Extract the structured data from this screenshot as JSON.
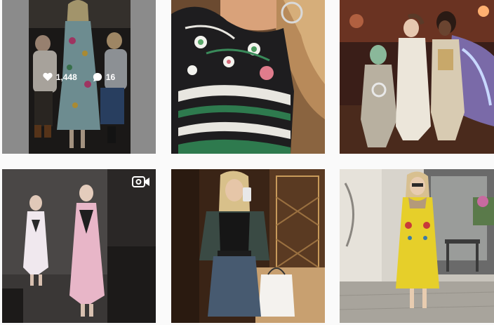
{
  "grid": {
    "posts": [
      {
        "stats": {
          "likes": "1,448",
          "comments": "16"
        },
        "hovered": true,
        "is_video": false,
        "icon": "heart-icon"
      },
      {
        "hovered": false,
        "is_video": false
      },
      {
        "hovered": false,
        "is_video": false
      },
      {
        "hovered": false,
        "is_video": true,
        "icon": "video-camera-icon"
      },
      {
        "hovered": false,
        "is_video": false
      },
      {
        "hovered": false,
        "is_video": false
      }
    ]
  },
  "colors": {
    "page_bg": "#fafafa",
    "overlay": "rgba(0,0,0,0.30)",
    "overlay_text": "#ffffff"
  }
}
